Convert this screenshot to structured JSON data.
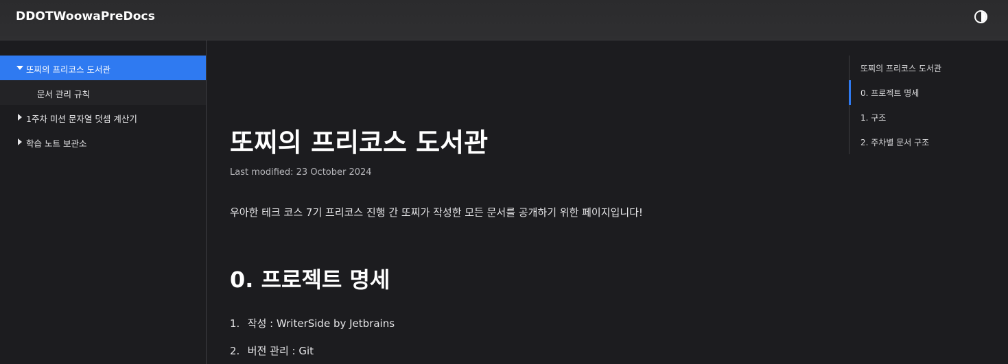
{
  "header": {
    "site_title": "DDOTWoowaPreDocs",
    "theme_icon": "half-circle-contrast-icon"
  },
  "sidebar": {
    "items": [
      {
        "label": "또찌의 프리코스 도서관",
        "state": "active-expanded"
      },
      {
        "label": "문서 관리 규칙",
        "state": "child"
      },
      {
        "label": "1주차 미션 문자열 덧셈 계산기",
        "state": "collapsed"
      },
      {
        "label": "학습 노트 보관소",
        "state": "collapsed"
      }
    ]
  },
  "toc": {
    "items": [
      {
        "label": "또찌의 프리코스 도서관"
      },
      {
        "label": "0. 프로젝트 명세",
        "active": true
      },
      {
        "label": "1. 구조"
      },
      {
        "label": "2. 주차별 문서 구조"
      }
    ]
  },
  "main": {
    "title": "또찌의 프리코스 도서관",
    "last_modified": "Last modified: 23 October 2024",
    "intro": "우아한 테크 코스 7기 프리코스 진행 간 또찌가 작성한 모든 문서를 공개하기 위한 페이지입니다!",
    "section_title": "0. 프로젝트 명세",
    "list": [
      {
        "num": "1.",
        "text": "작성 : WriterSide by Jetbrains"
      },
      {
        "num": "2.",
        "text": "버전 관리 : Git"
      }
    ]
  },
  "colors": {
    "accent": "#2f7af1",
    "background": "#1c1c1f",
    "header": "#2e2e30"
  }
}
